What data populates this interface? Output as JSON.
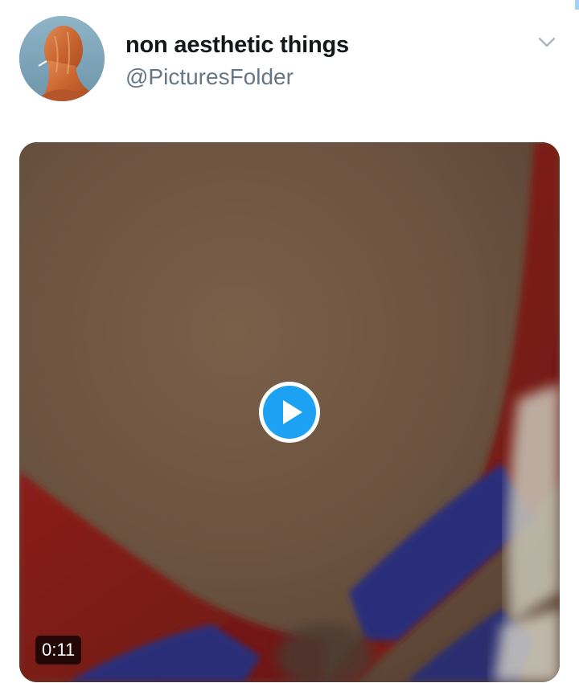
{
  "tweet": {
    "author": {
      "display_name": "non aesthetic things",
      "handle": "@PicturesFolder",
      "avatar_icon": "avatar-photo"
    },
    "menu_icon": "chevron-down-icon",
    "media": {
      "type": "video",
      "duration": "0:11",
      "play_icon": "play-icon",
      "accent_color": "#1da1f2"
    }
  }
}
